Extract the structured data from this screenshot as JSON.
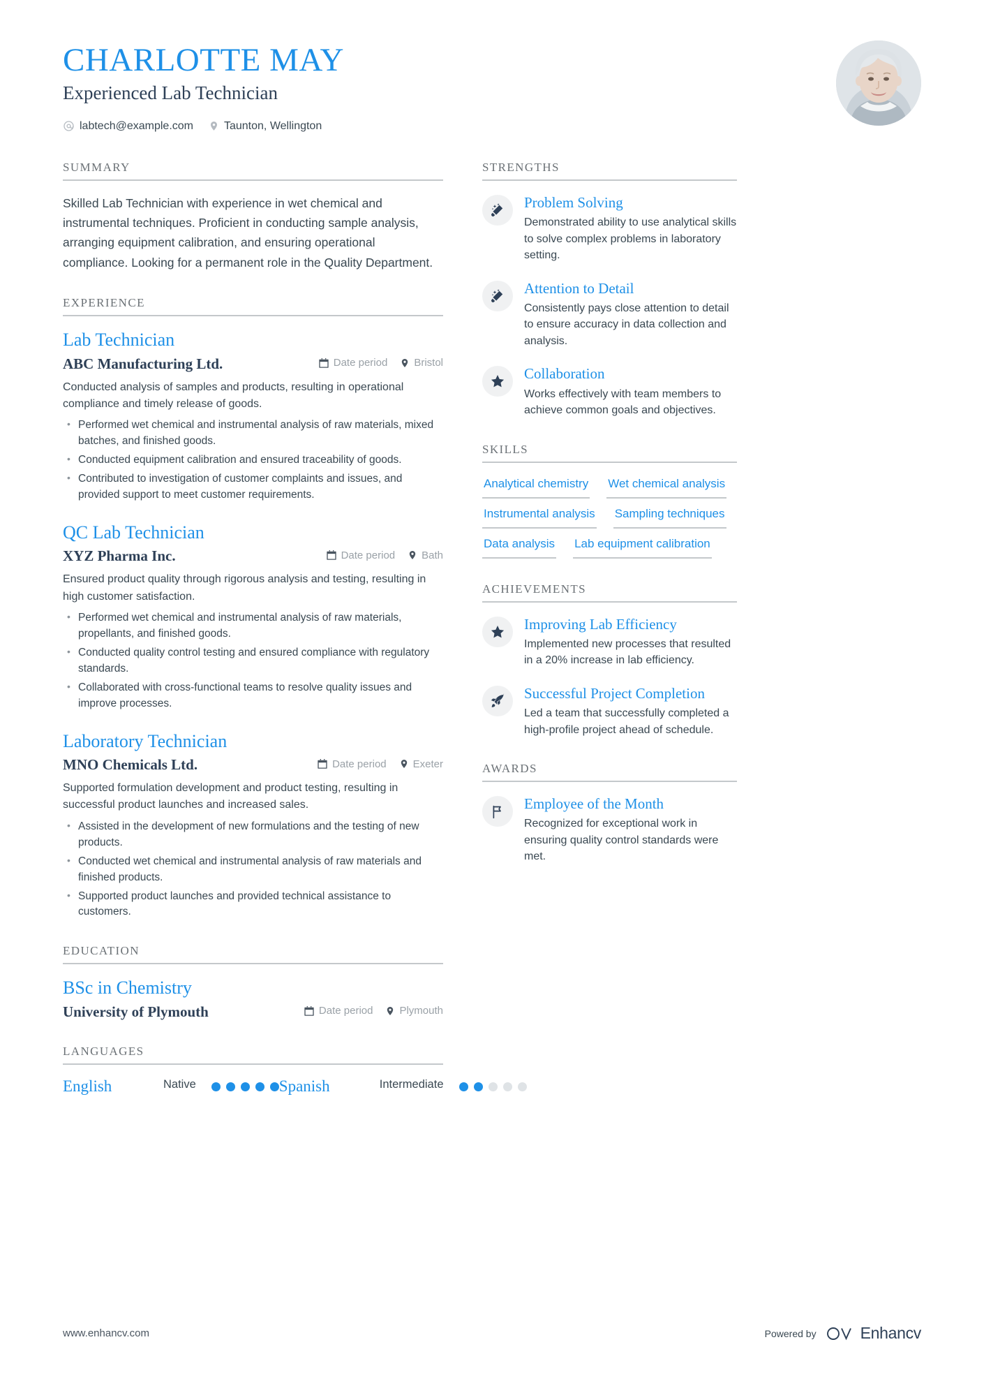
{
  "header": {
    "name": "CHARLOTTE MAY",
    "job_title": "Experienced Lab Technician",
    "email": "labtech@example.com",
    "location": "Taunton, Wellington",
    "accent_color": "#1E90E7",
    "dark_color": "#2E4057"
  },
  "summary": {
    "heading": "SUMMARY",
    "text": "Skilled Lab Technician with experience in wet chemical and instrumental techniques. Proficient in conducting sample analysis, arranging equipment calibration, and ensuring operational compliance. Looking for a permanent role in the Quality Department."
  },
  "experience": {
    "heading": "EXPERIENCE",
    "jobs": [
      {
        "role": "Lab Technician",
        "company": "ABC Manufacturing Ltd.",
        "date": "Date period",
        "location": "Bristol",
        "description": "Conducted analysis of samples and products, resulting in operational compliance and timely release of goods.",
        "bullets": [
          "Performed wet chemical and instrumental analysis of raw materials, mixed batches, and finished goods.",
          "Conducted equipment calibration and ensured traceability of goods.",
          "Contributed to investigation of customer complaints and issues, and provided support to meet customer requirements."
        ]
      },
      {
        "role": "QC Lab Technician",
        "company": "XYZ Pharma Inc.",
        "date": "Date period",
        "location": "Bath",
        "description": "Ensured product quality through rigorous analysis and testing, resulting in high customer satisfaction.",
        "bullets": [
          "Performed wet chemical and instrumental analysis of raw materials, propellants, and finished goods.",
          "Conducted quality control testing and ensured compliance with regulatory standards.",
          "Collaborated with cross-functional teams to resolve quality issues and improve processes."
        ]
      },
      {
        "role": "Laboratory Technician",
        "company": "MNO Chemicals Ltd.",
        "date": "Date period",
        "location": "Exeter",
        "description": "Supported formulation development and product testing, resulting in successful product launches and increased sales.",
        "bullets": [
          "Assisted in the development of new formulations and the testing of new products.",
          "Conducted wet chemical and instrumental analysis of raw materials and finished products.",
          "Supported product launches and provided technical assistance to customers."
        ]
      }
    ]
  },
  "education": {
    "heading": "EDUCATION",
    "items": [
      {
        "degree": "BSc in Chemistry",
        "school": "University of Plymouth",
        "date": "Date period",
        "location": "Plymouth"
      }
    ]
  },
  "languages": {
    "heading": "LANGUAGES",
    "items": [
      {
        "name": "English",
        "level": "Native",
        "rating": 5,
        "max": 5
      },
      {
        "name": "Spanish",
        "level": "Intermediate",
        "rating": 2,
        "max": 5
      }
    ]
  },
  "strengths": {
    "heading": "STRENGTHS",
    "items": [
      {
        "icon": "magic-wand-icon",
        "title": "Problem Solving",
        "description": "Demonstrated ability to use analytical skills to solve complex problems in laboratory setting."
      },
      {
        "icon": "magic-wand-icon",
        "title": "Attention to Detail",
        "description": "Consistently pays close attention to detail to ensure accuracy in data collection and analysis."
      },
      {
        "icon": "star-icon",
        "title": "Collaboration",
        "description": "Works effectively with team members to achieve common goals and objectives."
      }
    ]
  },
  "skills": {
    "heading": "SKILLS",
    "items": [
      "Analytical chemistry",
      "Wet chemical analysis",
      "Instrumental analysis",
      "Sampling techniques",
      "Data analysis",
      "Lab equipment calibration"
    ]
  },
  "achievements": {
    "heading": "ACHIEVEMENTS",
    "items": [
      {
        "icon": "star-icon",
        "title": "Improving Lab Efficiency",
        "description": "Implemented new processes that resulted in a 20% increase in lab efficiency."
      },
      {
        "icon": "rocket-icon",
        "title": "Successful Project Completion",
        "description": "Led a team that successfully completed a high-profile project ahead of schedule."
      }
    ]
  },
  "awards": {
    "heading": "AWARDS",
    "items": [
      {
        "icon": "flag-icon",
        "title": "Employee of the Month",
        "description": "Recognized for exceptional work in ensuring quality control standards were met."
      }
    ]
  },
  "footer": {
    "url": "www.enhancv.com",
    "powered_by": "Powered by",
    "brand": "Enhancv"
  }
}
